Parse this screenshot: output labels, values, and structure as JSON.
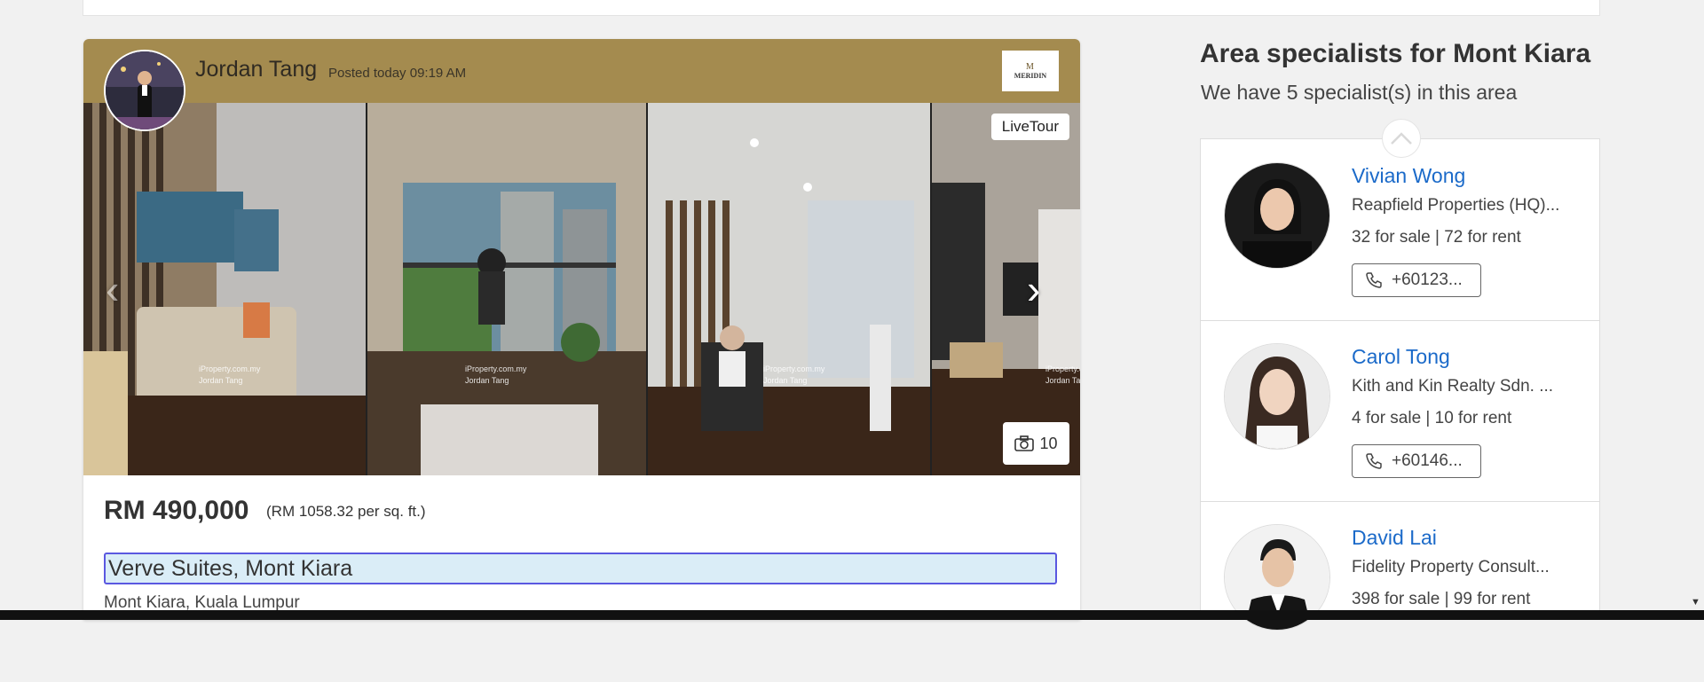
{
  "listing": {
    "agent_name": "Jordan Tang",
    "posted": "Posted today 09:19 AM",
    "logo_mark": "M",
    "logo_text": "MERIDIN",
    "badge_livetour": "LiveTour",
    "photo_count": "10",
    "watermark_site": "iProperty.com.my",
    "watermark_agent": "Jordan Tang",
    "price": "RM 490,000",
    "price_per_sqft": "(RM 1058.32 per sq. ft.)",
    "title": "Verve Suites, Mont Kiara",
    "location": "Mont Kiara, Kuala Lumpur"
  },
  "sidebar": {
    "title": "Area specialists for Mont Kiara",
    "subtitle": "We have 5 specialist(s) in this area",
    "specialists": [
      {
        "name": "Vivian Wong",
        "agency": "Reapfield Properties (HQ)...",
        "counts": "32 for sale | 72 for rent",
        "phone": "+60123..."
      },
      {
        "name": "Carol Tong",
        "agency": "Kith and Kin Realty Sdn. ...",
        "counts": "4 for sale | 10 for rent",
        "phone": "+60146..."
      },
      {
        "name": "David Lai",
        "agency": "Fidelity Property Consult...",
        "counts": "398 for sale | 99 for rent",
        "phone": ""
      }
    ]
  },
  "colors": {
    "header_gold": "#a48b4f",
    "link_blue": "#1b6ac9",
    "focus_border": "#5a58e0",
    "title_highlight": "#daedf7"
  },
  "icons": {
    "prev": "chevron-left-icon",
    "next": "chevron-right-icon",
    "camera": "camera-icon",
    "phone": "phone-icon",
    "collapse": "chevron-up-icon"
  }
}
